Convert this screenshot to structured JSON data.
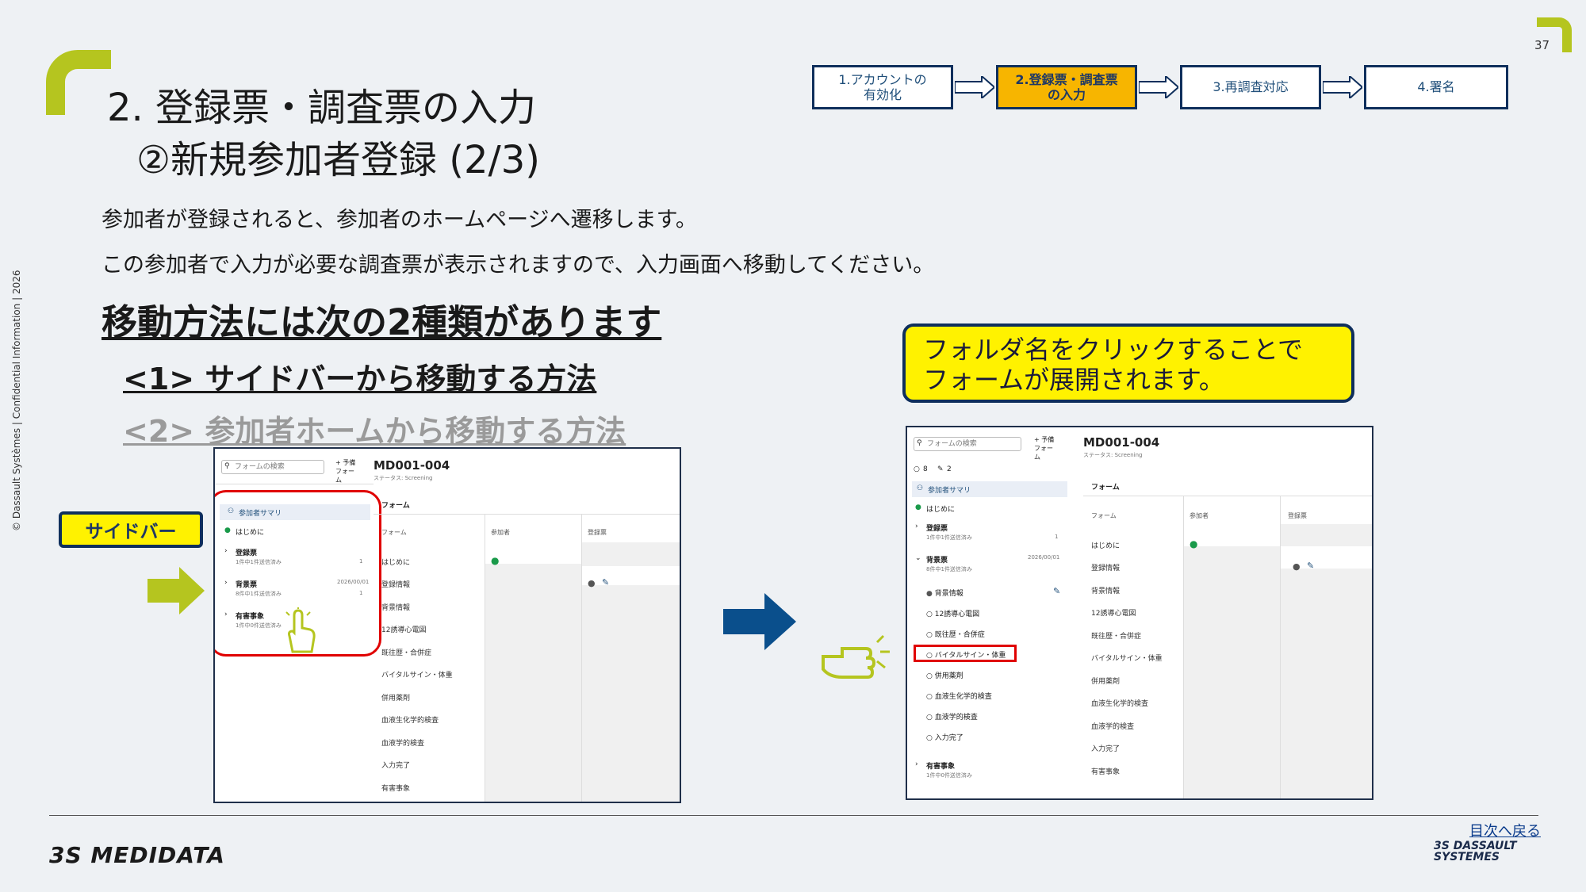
{
  "page_number": "37",
  "confidential": "© Dassault Systèmes | Confidential Information | 2026",
  "title_line1": "2. 登録票・調査票の入力",
  "title_line2": "②新規参加者登録 (2/3)",
  "steps": [
    {
      "label": "1.アカウントの\n有効化",
      "active": false
    },
    {
      "label": "2.登録票・調査票\nの入力",
      "active": true
    },
    {
      "label": "3.再調査対応",
      "active": false
    },
    {
      "label": "4.署名",
      "active": false
    }
  ],
  "para1": "参加者が登録されると、参加者のホームページへ遷移します。",
  "para2": "この参加者で入力が必要な調査票が表示されますので、入力画面へ移動してください。",
  "methods_heading": "移動方法には次の2種類があります",
  "method1": "<1> サイドバーから移動する方法",
  "method2": "<2> 参加者ホームから移動する方法",
  "callout": "フォルダ名をクリックすることで\nフォームが展開されます。",
  "sidebar_label": "サイドバー",
  "colors": {
    "accent": "#b5c51f",
    "navy": "#0f2f5c",
    "highlight": "#fff200",
    "active_step": "#f7b500",
    "red": "#e00000",
    "arrow_blue": "#0a4f8c"
  },
  "shot_left": {
    "search_placeholder": "フォームの検索",
    "add_button": "+ 予備フォーム",
    "subject_id": "MD001-004",
    "status": "ステータス: Screening",
    "sidebar": [
      {
        "label": "参加者サマリ",
        "sub": ""
      },
      {
        "label": "はじめに",
        "sub": ""
      },
      {
        "label": "登録票",
        "sub": "1件中1件送信済み",
        "count": "1"
      },
      {
        "label": "背景票",
        "sub": "8件中1件送信済み",
        "date": "2026/00/01",
        "count": "1"
      },
      {
        "label": "有害事象",
        "sub": "1件中0件送信済み"
      }
    ],
    "forms_title": "フォーム",
    "columns": [
      "フォーム",
      "参加者",
      "登録票"
    ],
    "rows": [
      "はじめに",
      "登録情報",
      "背景情報",
      "12誘導心電図",
      "既往歴・合併症",
      "バイタルサイン・体重",
      "併用薬剤",
      "血液生化学的検査",
      "血液学的検査",
      "入力完了",
      "有害事象"
    ]
  },
  "shot_right": {
    "search_placeholder": "フォームの検索",
    "add_button": "+ 予備フォーム",
    "subject_id": "MD001-004",
    "status": "ステータス: Screening",
    "counts": [
      "8",
      "2"
    ],
    "sidebar": [
      {
        "label": "参加者サマリ",
        "sub": ""
      },
      {
        "label": "はじめに",
        "sub": ""
      },
      {
        "label": "登録票",
        "sub": "1件中1件送信済み",
        "count": "1"
      },
      {
        "label": "背景票",
        "sub": "8件中1件送信済み",
        "date": "2026/00/01"
      },
      {
        "label": "背景情報",
        "sub": ""
      },
      {
        "label": "12誘導心電図",
        "sub": ""
      },
      {
        "label": "既往歴・合併症",
        "sub": ""
      },
      {
        "label": "バイタルサイン・体重",
        "sub": ""
      },
      {
        "label": "併用薬剤",
        "sub": ""
      },
      {
        "label": "血液生化学的検査",
        "sub": ""
      },
      {
        "label": "血液学的検査",
        "sub": ""
      },
      {
        "label": "入力完了",
        "sub": ""
      },
      {
        "label": "有害事象",
        "sub": "1件中0件送信済み"
      }
    ],
    "forms_title": "フォーム",
    "columns": [
      "フォーム",
      "参加者",
      "登録票"
    ],
    "rows": [
      "はじめに",
      "登録情報",
      "背景情報",
      "12誘導心電図",
      "既往歴・合併症",
      "バイタルサイン・体重",
      "併用薬剤",
      "血液生化学的検査",
      "血液学的検査",
      "入力完了",
      "有害事象"
    ]
  },
  "footer": {
    "brand": "3S MEDIDATA",
    "toc_link": "目次へ戻る",
    "dassault": "3S DASSAULT\nSYSTEMES"
  }
}
